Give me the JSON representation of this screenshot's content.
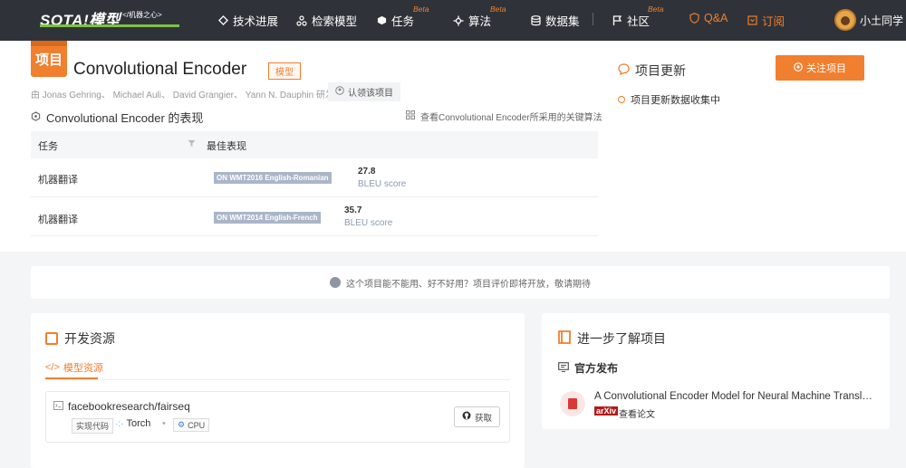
{
  "nav": {
    "logo_text": "SOTA!模型",
    "logo_tagline": "</机器之心>",
    "items": [
      {
        "label": "技术进展",
        "icon": "tech-icon"
      },
      {
        "label": "检索模型",
        "icon": "search-model-icon"
      },
      {
        "label": "任务",
        "icon": "task-icon",
        "beta": "Beta"
      },
      {
        "label": "算法",
        "icon": "algorithm-icon",
        "beta": "Beta"
      },
      {
        "label": "数据集",
        "icon": "dataset-icon"
      },
      {
        "label": "社区",
        "icon": "community-flag-icon",
        "beta": "Beta"
      },
      {
        "label": "Q&A",
        "icon": "qa-shield-icon"
      },
      {
        "label": "订阅",
        "icon": "subscribe-icon"
      }
    ],
    "username": "小土同学"
  },
  "project": {
    "tag": "项目",
    "title": "Convolutional Encoder",
    "badge": "模型",
    "authors": "由 Jonas Gehring、 Michael Auli、 David Grangier、 Yann N. Dauphin 研发",
    "claim_label": "认领该项目"
  },
  "performance": {
    "title": "Convolutional Encoder 的表现",
    "algo_link": "查看Convolutional Encoder所采用的关键算法",
    "col_task": "任务",
    "col_best": "最佳表现",
    "rows": [
      {
        "task": "机器翻译",
        "dataset": "ON WMT2016 English-Romanian",
        "score": "27.8",
        "metric": "BLEU score"
      },
      {
        "task": "机器翻译",
        "dataset": "ON WMT2014 English-French",
        "score": "35.7",
        "metric": "BLEU score"
      }
    ]
  },
  "updates": {
    "title": "项目更新",
    "follow_label": "关注项目",
    "item": "项目更新数据收集中"
  },
  "notice": "这个项目能不能用、好不好用？项目评价即将开放，敬请期待",
  "dev_resources": {
    "title": "开发资源",
    "tab": "模型资源",
    "repo": "facebookresearch/fairseq",
    "tag_code": "实现代码",
    "framework": "Torch",
    "device": "CPU",
    "get_label": "获取"
  },
  "learn_more": {
    "title": "进一步了解项目",
    "official": "官方发布",
    "paper_title": "A Convolutional Encoder Model for Neural Machine Translation",
    "source": "arXiv",
    "view_label": "查看论文"
  },
  "colors": {
    "accent": "#f07f2f",
    "nav_bg": "#2f3339",
    "badge_bg": "#aab6c8"
  }
}
